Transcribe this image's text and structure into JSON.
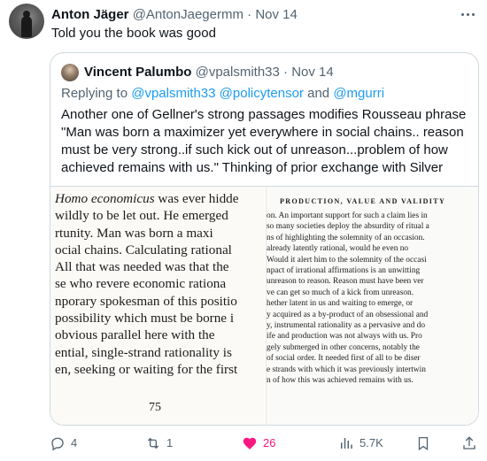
{
  "tweet": {
    "author_name": "Anton Jäger",
    "author_handle": "@AntonJaegermm",
    "separator": "·",
    "date": "Nov 14",
    "text": "Told you the book was good"
  },
  "quoted": {
    "author_name": "Vincent Palumbo",
    "author_handle": "@vpalsmith33",
    "separator": "·",
    "date": "Nov 14",
    "replying_prefix": "Replying to ",
    "mentions": [
      "@vpalsmith33",
      "@policytensor",
      "@mgurri"
    ],
    "and_word": " and ",
    "body": "Another one of Gellner's strong passages modifies Rousseau phrase \"Man was born a maximizer yet everywhere in social chains.. reason must be very strong..if such kick out of unreason...problem of how achieved remains with us.\" Thinking of prior exchange with Silver",
    "media": {
      "left_page_lines": [
        "Homo economicus was ever hidde",
        " wildly to be let out. He emerged",
        "rtunity. Man was born a maxi",
        "ocial chains. Calculating rational",
        "All that was needed was that the",
        "se who revere economic rationa",
        "nporary spokesman of this positio",
        "possibility which must be borne i",
        " obvious parallel here with the",
        "ential, single-strand rationality is",
        "en, seeking or waiting for the first"
      ],
      "left_page_number": "75",
      "right_page_heading": "PRODUCTION, VALUE AND VALIDITY",
      "right_page_lines": [
        "on. An important support for such a claim lies in",
        "so many societies deploy the absurdity of ritual a",
        "ns of highlighting the solemnity of an occasion.",
        "already latently rational, would he even no",
        "Would it alert him to the solemnity of the occasi",
        "npact of irrational affirmations is an unwitting",
        "unreason to reason. Reason must have been ver",
        "ve can get so much of a kick from unreason.",
        "hether latent in us and waiting to emerge, or",
        "y acquired as a by-product of an obsessional and",
        "y, instrumental rationality as a pervasive and do",
        "ife and production was not always with us. Pro",
        "gely submerged in other concerns, notably the",
        "of social order. It needed first of all to be diser",
        "e strands with which it was previously intertwin",
        "n of how this was achieved remains with us."
      ]
    }
  },
  "actions": {
    "replies": "4",
    "reposts": "1",
    "likes": "26",
    "views": "5.7K"
  },
  "colors": {
    "text": "#0f1419",
    "muted": "#536471",
    "link": "#1d9bf0",
    "like": "#f91880",
    "border": "#cfd9de"
  }
}
